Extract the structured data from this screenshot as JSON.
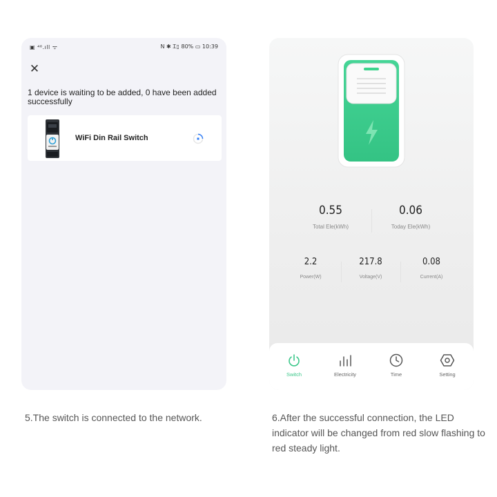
{
  "left_screen": {
    "status_bar": {
      "left": "▣ ⁴⁶.ıll ᯤ",
      "right": "N ✱ Ꮖ▯ 80% ▭ 10:39"
    },
    "close_icon": "close-icon",
    "waiting_message": "1 device is waiting to be added, 0 have been added successfully",
    "device": {
      "name": "WiFi Din Rail Switch",
      "status_icon": "loading-spinner-icon"
    }
  },
  "right_screen": {
    "stats_top": [
      {
        "value": "0.55",
        "label": "Total Ele(kWh)"
      },
      {
        "value": "0.06",
        "label": "Today Ele(kWh)"
      }
    ],
    "stats_bottom": [
      {
        "value": "2.2",
        "label": "Power(W)"
      },
      {
        "value": "217.8",
        "label": "Voltage(V)"
      },
      {
        "value": "0.08",
        "label": "Current(A)"
      }
    ],
    "tabs": [
      {
        "label": "Switch",
        "icon": "power-icon",
        "active": true
      },
      {
        "label": "Electricity",
        "icon": "bar-chart-icon",
        "active": false
      },
      {
        "label": "Time",
        "icon": "clock-icon",
        "active": false
      },
      {
        "label": "Setting",
        "icon": "settings-icon",
        "active": false
      }
    ],
    "colors": {
      "accent": "#3cc78a"
    }
  },
  "captions": {
    "left": "5.The switch is connected to the network.",
    "right": "6.After the successful connection, the LED indicator will be changed from red slow flashing to red steady light."
  }
}
